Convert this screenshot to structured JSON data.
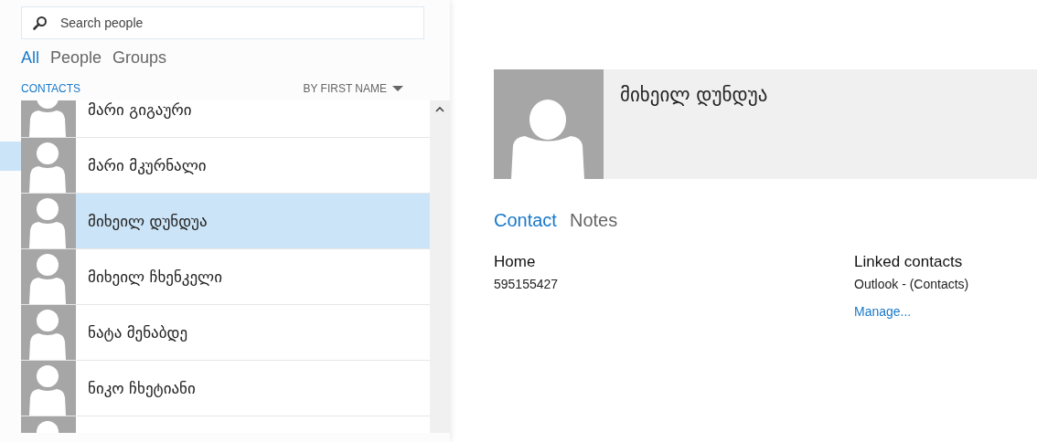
{
  "search": {
    "placeholder": "Search people"
  },
  "filters": [
    {
      "label": "All",
      "selected": true
    },
    {
      "label": "People",
      "selected": false
    },
    {
      "label": "Groups",
      "selected": false
    }
  ],
  "list_header": {
    "title": "CONTACTS",
    "sort": "BY FIRST NAME"
  },
  "contacts": [
    {
      "name": "მარი გიგაური",
      "selected": false
    },
    {
      "name": "მარი მკურნალი",
      "selected": false
    },
    {
      "name": "მიხეილ დუნდუა",
      "selected": true
    },
    {
      "name": "მიხეილ ჩხენკელი",
      "selected": false
    },
    {
      "name": "ნატა მენაბდე",
      "selected": false
    },
    {
      "name": "ნიკო ჩხეტიანი",
      "selected": false
    },
    {
      "selected": false
    }
  ],
  "detail": {
    "name": "მიხეილ დუნდუა",
    "tabs": [
      {
        "label": "Contact",
        "selected": true
      },
      {
        "label": "Notes",
        "selected": false
      }
    ],
    "phone": {
      "label": "Home",
      "value": "595155427"
    },
    "linked": {
      "label": "Linked contacts",
      "value": "Outlook - (Contacts)",
      "link": "Manage..."
    }
  }
}
